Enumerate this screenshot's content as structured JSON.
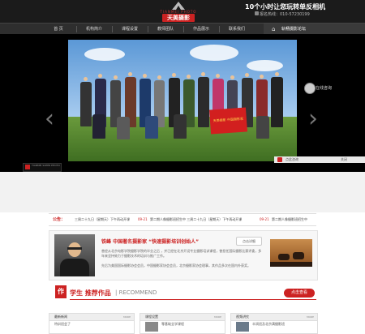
{
  "header": {
    "logo_brand": "TIANMEI PHOTO",
    "logo_name": "天美摄影",
    "slogan": "10个小时让您玩转单反相机",
    "hotline": "报名热线：010-57230199"
  },
  "nav": {
    "items": [
      "首 页",
      "机构简介",
      "课程设置",
      "教师团队",
      "作品展示",
      "联系我们"
    ],
    "forum": "轨畅摄影论坛"
  },
  "banner": {
    "flag_text": "天美摄影 中国摄影家",
    "consult": "在线咨询",
    "badge": "TIANMEI SUPER PHOTO",
    "ad_text": "点此咨询",
    "ad_close": "关闭"
  },
  "notice": {
    "label": "公告：",
    "items": [
      {
        "date": "",
        "text": "三周二十九日（星期天）下午再动开课"
      },
      {
        "date": "09-21",
        "text": "第二期人像摄影班招生中 三周二十九日（星期天）下午再动开课"
      },
      {
        "date": "09-21",
        "text": "第二期人像摄影班招生中"
      }
    ]
  },
  "teacher": {
    "title": "铁峰  中国著名摄影家  “快速摄影培训创始人”",
    "more": "点击详细",
    "desc1": "曾经从北京电影学院摄影学院的毕业之后 ，并已经在北京开设专业摄影培训课程，曾担任国际摄影比赛评委，多年来坚持致力于摄影技术的培训与推广工作。",
    "desc2": "先后为美国国际摄影协会会员，中国摄影家协会会员，北京摄影家协会理事，其作品多次在国内外获奖。"
  },
  "recommend": {
    "icon": "作",
    "title": "学生 推荐作品",
    "title_en": "| RECOMMEND",
    "button": "点击查看"
  },
  "columns": [
    {
      "title": "最新新闻",
      "more": "MORE",
      "text": "特训班会了"
    },
    {
      "title": "课程设置",
      "more": "MORE",
      "text": "零基础全学课程"
    },
    {
      "title": "视频讲究",
      "more": "MORE",
      "text": "丰润班及北京满摄影班"
    }
  ]
}
